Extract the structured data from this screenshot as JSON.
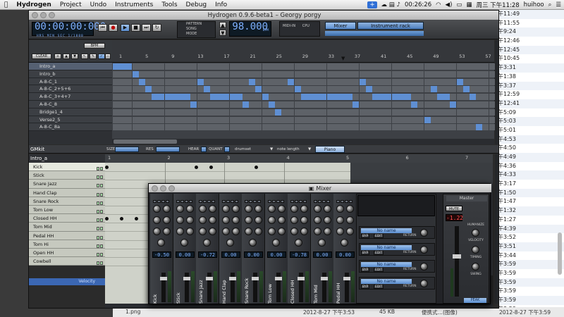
{
  "menubar": {
    "apple": "",
    "app": "Hydrogen",
    "items": [
      "Project",
      "Undo",
      "Instruments",
      "Tools",
      "Debug",
      "Info"
    ],
    "clock_status": "00:26:26",
    "date_time": "周三 下午11:28",
    "user": "huihoo"
  },
  "window": {
    "title": "Hydrogen 0.9.6-beta1 – Georgy porgy"
  },
  "toolbar": {
    "timer": "00:00:00:000",
    "timer_units": "HRS  MIN  SEC  1/1000",
    "mode_pattern": "PATTERN",
    "mode_song": "SONG",
    "mode_label": "MODE",
    "bpm": "98.000",
    "bpm_unit": "BPM",
    "midi": "MIDI-IN",
    "cpu": "CPU",
    "tab_mixer": "Mixer",
    "tab_rack": "Instrument rack"
  },
  "song_editor": {
    "bpm_button": "BPM",
    "clear_button": "CLEAR",
    "ruler": [
      "1",
      "5",
      "9",
      "13",
      "17",
      "21",
      "25",
      "29",
      "33",
      "37",
      "41",
      "45",
      "49",
      "53",
      "57"
    ],
    "patterns": [
      "Intro_a",
      "Intro_b",
      "A-8-C_1",
      "A-8-C_2+5+6",
      "A-8-C_3+4+7",
      "A-8-C_8",
      "Bridge1_4",
      "Verse2_5",
      "A-8-C_8a"
    ],
    "active": [
      [
        0,
        1,
        2
      ],
      [
        3
      ],
      [
        4,
        13,
        21,
        27,
        38,
        53
      ],
      [
        5,
        14,
        22,
        28,
        39,
        49,
        54
      ],
      [
        6,
        7,
        8,
        9,
        10,
        11,
        15,
        16,
        17,
        18,
        19,
        23,
        29,
        30,
        31,
        32,
        33,
        34,
        35,
        36,
        40,
        41,
        42,
        43,
        44,
        45,
        50,
        51,
        55
      ],
      [
        12,
        20,
        24,
        37,
        46,
        52
      ],
      [
        25
      ],
      [
        48
      ],
      [
        56
      ]
    ]
  },
  "pattern_editor": {
    "kit": "GMkit",
    "size_label": "SIZE",
    "res_label": "RES",
    "hear_label": "HEAR",
    "quant_label": "QUANT",
    "drumset": "drumset",
    "note_length": "note length",
    "piano": "Piano",
    "pattern_name": "Intro_a",
    "ruler": [
      "1",
      "2",
      "3",
      "4",
      "5",
      "6",
      "7"
    ],
    "instruments": [
      "Kick",
      "Stick",
      "Snare Jazz",
      "Hand Clap",
      "Snare Rock",
      "Tom Low",
      "Closed HH",
      "Tom Mid",
      "Pedal HH",
      "Tom Hi",
      "Open HH",
      "Cowbell"
    ],
    "notes": {
      "Kick": [
        0,
        6,
        7,
        10
      ],
      "Closed HH": [
        0,
        1,
        2,
        3
      ]
    },
    "velocity_label": "Velocity"
  },
  "mixer": {
    "title": "Mixer",
    "channels": [
      {
        "name": "Kick",
        "value": "-0.50"
      },
      {
        "name": "Stick",
        "value": "0.00"
      },
      {
        "name": "Snare Jazz",
        "value": "-0.72"
      },
      {
        "name": "Hand Clap",
        "value": "0.00"
      },
      {
        "name": "Snare Rock",
        "value": "0.00"
      },
      {
        "name": "Tom Low",
        "value": "0.00"
      },
      {
        "name": "Closed HH",
        "value": "-0.78"
      },
      {
        "name": "Tom Mid",
        "value": "0.00"
      },
      {
        "name": "Pedal HH",
        "value": "0.00"
      }
    ],
    "fx": [
      "No name",
      "No name",
      "No name",
      "No name"
    ],
    "fx_byp": "BYP",
    "fx_edit": "EDIT",
    "fx_return": "RETURN",
    "master_title": "Master",
    "mute": "MUTE",
    "master_volume": "-1.22",
    "humanize": "HUMANIZE",
    "velocity": "VELOCITY",
    "timing": "TIMING",
    "swing": "SWING",
    "peak": "PEAK"
  },
  "background": {
    "times": [
      "午11:49",
      "午11:55",
      "午9:24",
      "午12:46",
      "午12:45",
      "午10:45",
      "午3:31",
      "午1:38",
      "午3:37",
      "午12:59",
      "午12:41",
      "午5:09",
      "午5:03",
      "午5:01",
      "午4:53",
      "午4:50",
      "午4:49",
      "午4:36",
      "午4:33",
      "午3:17",
      "午1:50",
      "午1:47",
      "午1:32",
      "午1:27",
      "午4:39",
      "午3:52",
      "午3:51",
      "午3:44",
      "午3:59",
      "午3:59",
      "午3:59",
      "午3:59",
      "午3:59",
      "午3:59"
    ],
    "status_file": "1.png",
    "status_date": "2012-8-27 下午3:53",
    "status_size": "45 KB",
    "status_kind": "便携式…(图像)",
    "status_date2": "2012-8-27 下午3:59"
  },
  "colors": {
    "accent": "#5f8fd3",
    "lcd_text": "#7fb0ff",
    "master_red": "#ff5050"
  }
}
